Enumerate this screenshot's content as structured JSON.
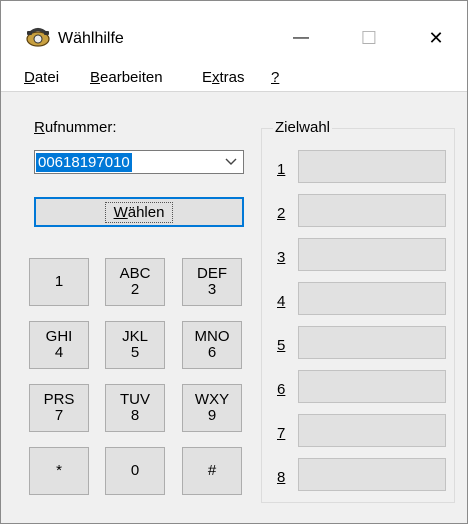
{
  "window": {
    "title": "Wählhilfe",
    "controls": {
      "minimize": "—",
      "maximize": "☐",
      "close": "✕"
    }
  },
  "menu": [
    {
      "accel": "D",
      "rest": "atei"
    },
    {
      "accel": "B",
      "rest": "earbeiten"
    },
    {
      "pre": "E",
      "accel": "x",
      "rest": "tras"
    },
    {
      "accel": "?",
      "rest": ""
    }
  ],
  "phone": {
    "label_accel": "R",
    "label_rest": "ufnummer:",
    "value": "00618197010"
  },
  "dial_button": {
    "accel": "W",
    "rest": "ählen"
  },
  "keypad": [
    {
      "letters": "",
      "digit": "1"
    },
    {
      "letters": "ABC",
      "digit": "2"
    },
    {
      "letters": "DEF",
      "digit": "3"
    },
    {
      "letters": "GHI",
      "digit": "4"
    },
    {
      "letters": "JKL",
      "digit": "5"
    },
    {
      "letters": "MNO",
      "digit": "6"
    },
    {
      "letters": "PRS",
      "digit": "7"
    },
    {
      "letters": "TUV",
      "digit": "8"
    },
    {
      "letters": "WXY",
      "digit": "9"
    },
    {
      "letters": "",
      "digit": "*"
    },
    {
      "letters": "",
      "digit": "0"
    },
    {
      "letters": "",
      "digit": "#"
    }
  ],
  "speed_dial": {
    "title": "Zielwahl",
    "numbers": [
      "1",
      "2",
      "3",
      "4",
      "5",
      "6",
      "7",
      "8"
    ]
  }
}
